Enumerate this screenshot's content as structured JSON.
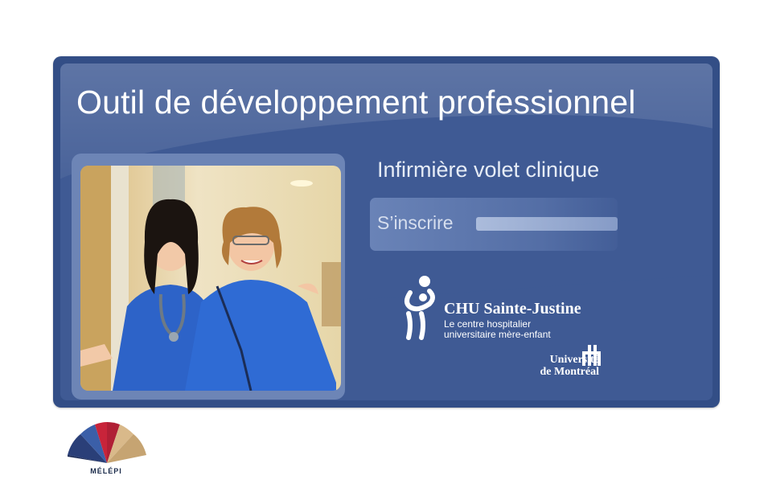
{
  "title": "Outil de développement professionnel",
  "subtitle": "Infirmière volet clinique",
  "signup": {
    "label": "S’inscrire"
  },
  "chu": {
    "name": "CHU Sainte-Justine",
    "line1": "Le centre hospitalier",
    "line2": "universitaire mère-enfant"
  },
  "udem": {
    "line1": "Université",
    "line2": "de Montréal"
  },
  "melepi": {
    "label": "MÉLÉPI"
  },
  "icons": [
    "chu-sainte-justine-logo-icon",
    "universite-de-montreal-logo-icon",
    "melepi-fan-logo-icon"
  ],
  "colors": {
    "card": "#334e86",
    "card_inner": "#3f5a94",
    "text": "#ffffff"
  }
}
